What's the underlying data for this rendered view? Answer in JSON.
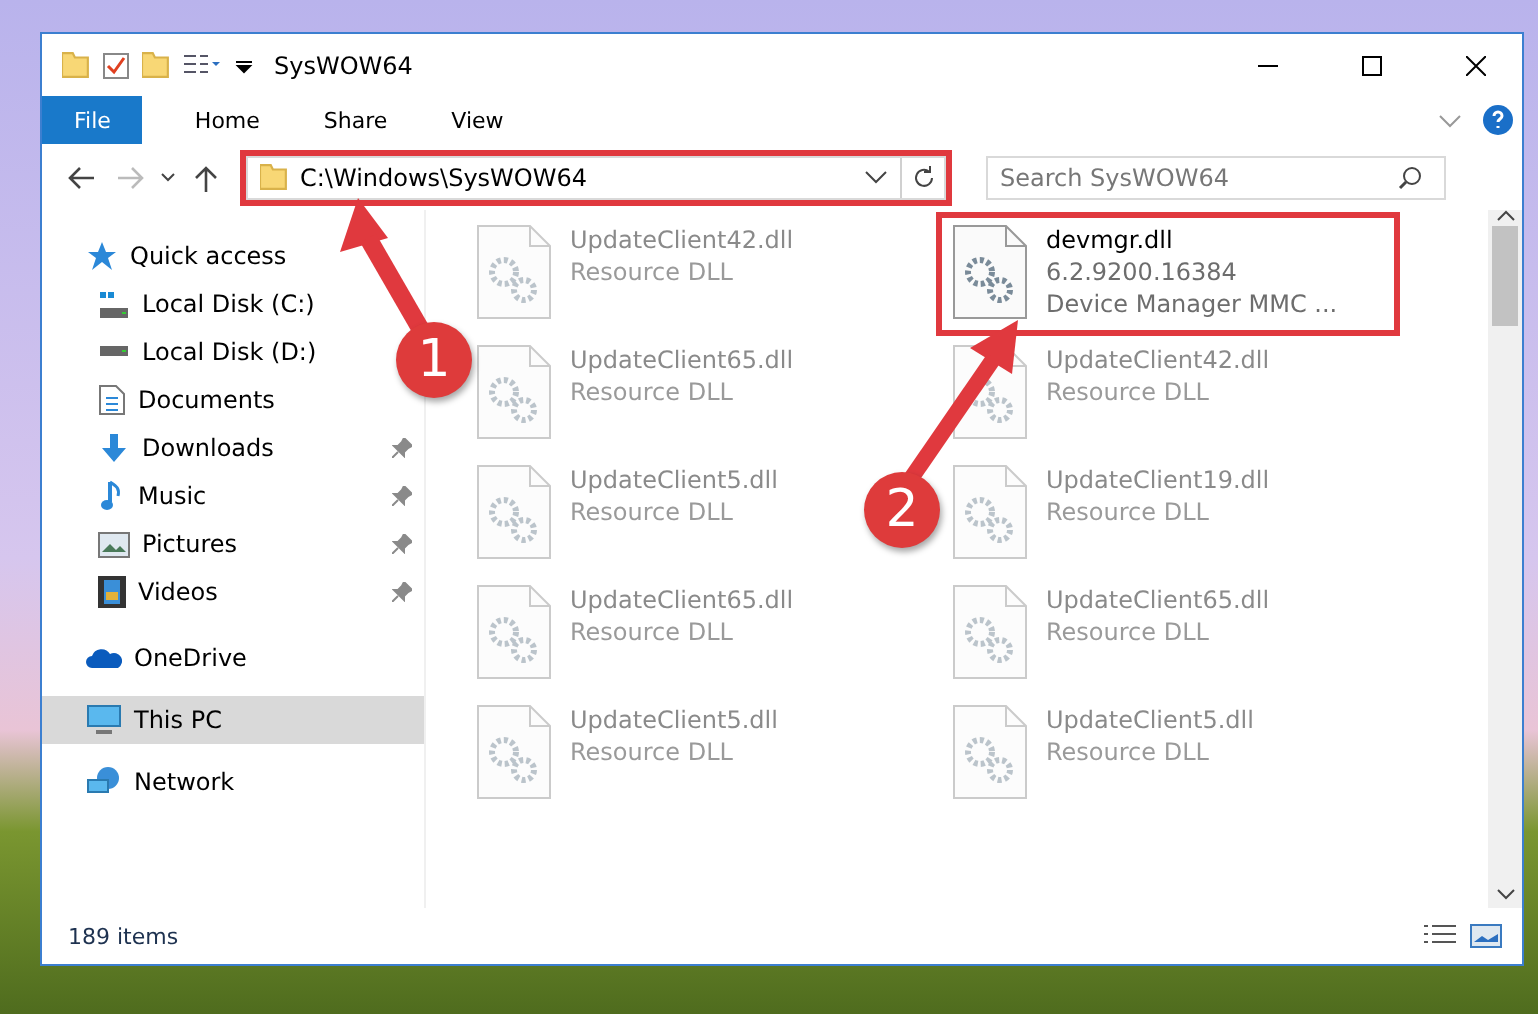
{
  "window": {
    "title": "SysWOW64"
  },
  "ribbon": {
    "tabs": [
      {
        "label": "File",
        "selected": true
      },
      {
        "label": "Home",
        "selected": false
      },
      {
        "label": "Share",
        "selected": false
      },
      {
        "label": "View",
        "selected": false
      }
    ]
  },
  "address": {
    "path": "C:\\Windows\\SysWOW64"
  },
  "search": {
    "placeholder": "Search SysWOW64"
  },
  "sidebar": {
    "items": [
      {
        "label": "Quick access",
        "kind": "star",
        "selected": false,
        "children": [
          {
            "label": "Local Disk (C:)",
            "kind": "drive-win",
            "pinned": false,
            "selected": false
          },
          {
            "label": "Local Disk (D:)",
            "kind": "drive",
            "pinned": false,
            "selected": false
          },
          {
            "label": "Documents",
            "kind": "document",
            "pinned": false,
            "selected": false
          },
          {
            "label": "Downloads",
            "kind": "download",
            "pinned": true,
            "selected": false
          },
          {
            "label": "Music",
            "kind": "music",
            "pinned": true,
            "selected": false
          },
          {
            "label": "Pictures",
            "kind": "pictures",
            "pinned": true,
            "selected": false
          },
          {
            "label": "Videos",
            "kind": "video",
            "pinned": true,
            "selected": false
          }
        ]
      },
      {
        "label": "OneDrive",
        "kind": "cloud",
        "selected": false
      },
      {
        "label": "This PC",
        "kind": "pc",
        "selected": true
      },
      {
        "label": "Network",
        "kind": "network",
        "selected": false
      }
    ]
  },
  "files": [
    {
      "lines": [
        "UpdateClient42.dll",
        "Resource DLL"
      ],
      "dimmed": true,
      "highlighted": false
    },
    {
      "lines": [
        "devmgr.dll",
        "6.2.9200.16384",
        "Device Manager MMC ..."
      ],
      "dimmed": false,
      "highlighted": true
    },
    {
      "lines": [
        "UpdateClient65.dll",
        "Resource DLL"
      ],
      "dimmed": true,
      "highlighted": false
    },
    {
      "lines": [
        "UpdateClient42.dll",
        "Resource DLL"
      ],
      "dimmed": true,
      "highlighted": false
    },
    {
      "lines": [
        "UpdateClient5.dll",
        "Resource DLL"
      ],
      "dimmed": true,
      "highlighted": false
    },
    {
      "lines": [
        "UpdateClient19.dll",
        "Resource DLL"
      ],
      "dimmed": true,
      "highlighted": false
    },
    {
      "lines": [
        "UpdateClient65.dll",
        "Resource DLL"
      ],
      "dimmed": true,
      "highlighted": false
    },
    {
      "lines": [
        "UpdateClient65.dll",
        "Resource DLL"
      ],
      "dimmed": true,
      "highlighted": false
    },
    {
      "lines": [
        "UpdateClient5.dll",
        "Resource DLL"
      ],
      "dimmed": true,
      "highlighted": false
    },
    {
      "lines": [
        "UpdateClient5.dll",
        "Resource DLL"
      ],
      "dimmed": true,
      "highlighted": false
    }
  ],
  "status_bar": {
    "count": "189 items"
  },
  "callouts": [
    {
      "number": "1"
    },
    {
      "number": "2"
    }
  ]
}
